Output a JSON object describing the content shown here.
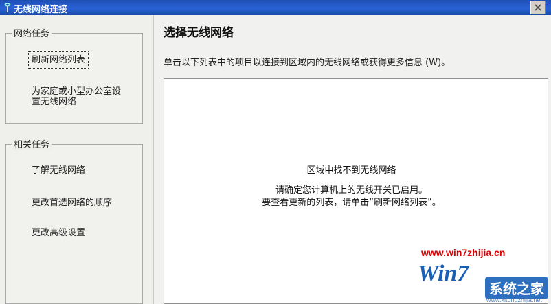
{
  "window": {
    "title": "无线网络连接"
  },
  "sidebar": {
    "network_tasks": {
      "title": "网络任务",
      "items": [
        {
          "label": "刷新网络列表"
        },
        {
          "label_line1": "为家庭或小型办公室设",
          "label_line2": "置无线网络"
        }
      ]
    },
    "related_tasks": {
      "title": "相关任务",
      "items": [
        {
          "label": "了解无线网络"
        },
        {
          "label": "更改首选网络的顺序"
        },
        {
          "label": "更改高级设置"
        }
      ]
    }
  },
  "main": {
    "heading": "选择无线网络",
    "description": "单击以下列表中的项目以连接到区域内的无线网络或获得更多信息 (W)。",
    "empty_title": "区域中找不到无线网络",
    "empty_line1": "请确定您计算机上的无线开关已启用。",
    "empty_line2": "要查看更新的列表，请单击“刷新网络列表”。"
  },
  "watermark": {
    "url": "www.win7zhijia.cn",
    "logo_text": "Win7",
    "site_name": "系统之家",
    "site_sub": "www.xitongzhijia.net"
  },
  "colors": {
    "titlebar": "#2a62d6",
    "watermark_red": "#d00000",
    "watermark_blue": "#1a5fb4"
  }
}
